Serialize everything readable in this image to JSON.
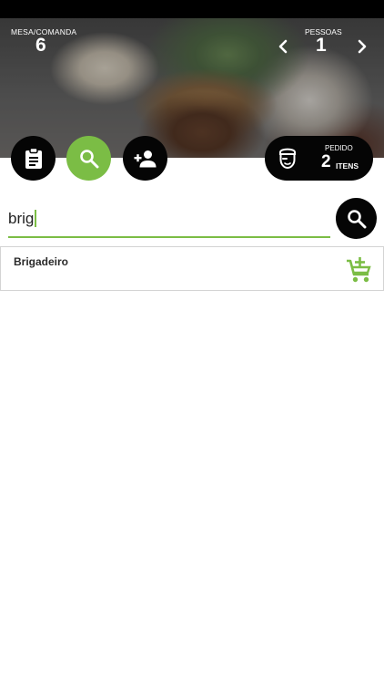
{
  "header": {
    "mesa_label": "MESA/COMANDA",
    "mesa_value": "6",
    "pessoas_label": "PESSOAS",
    "pessoas_value": "1"
  },
  "icons": {
    "prev": "chevron-left-icon",
    "next": "chevron-right-icon",
    "clipboard": "clipboard-icon",
    "search": "search-icon",
    "add_person": "add-person-icon",
    "waiter": "waiter-icon",
    "cart": "add-to-cart-icon"
  },
  "colors": {
    "accent": "#7bbd45",
    "button_dark": "#050505"
  },
  "pedido": {
    "label": "PEDIDO",
    "count": "2",
    "unit": "ITENS"
  },
  "search": {
    "value": "brig"
  },
  "results": [
    {
      "name": "Brigadeiro"
    }
  ]
}
